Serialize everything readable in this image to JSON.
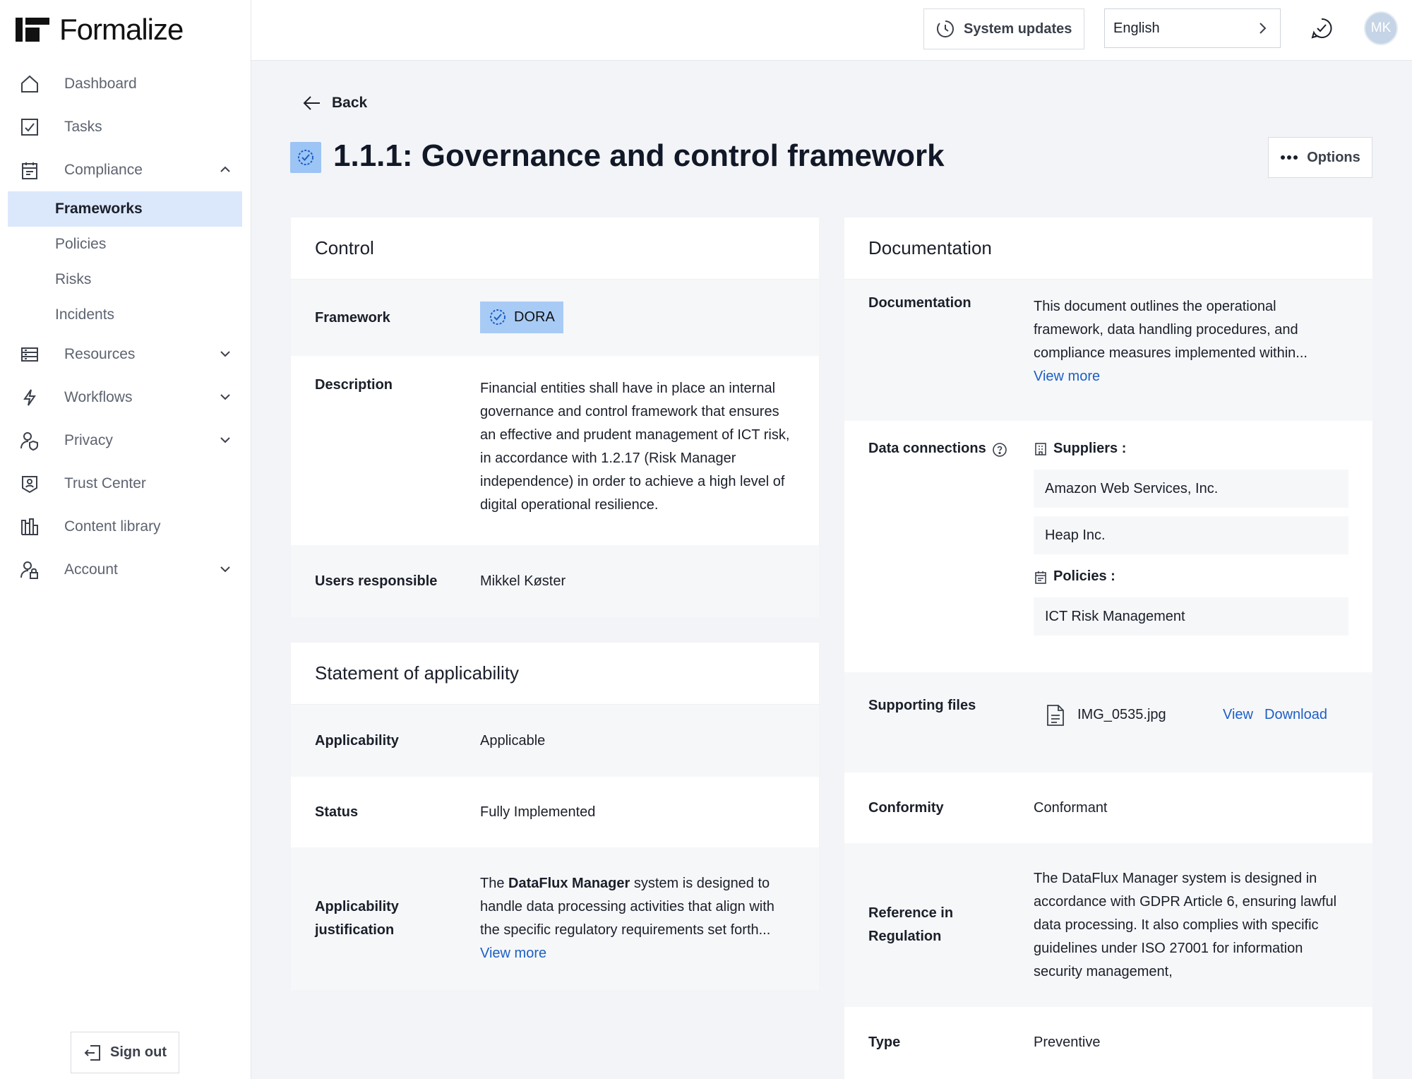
{
  "app": {
    "name": "Formalize"
  },
  "sidebar": {
    "items": [
      {
        "label": "Dashboard"
      },
      {
        "label": "Tasks"
      },
      {
        "label": "Compliance"
      },
      {
        "label": "Resources"
      },
      {
        "label": "Workflows"
      },
      {
        "label": "Privacy"
      },
      {
        "label": "Trust Center"
      },
      {
        "label": "Content library"
      },
      {
        "label": "Account"
      }
    ],
    "compliance_sub": [
      {
        "label": "Frameworks",
        "active": true
      },
      {
        "label": "Policies"
      },
      {
        "label": "Risks"
      },
      {
        "label": "Incidents"
      }
    ],
    "sign_out": "Sign out"
  },
  "topbar": {
    "system_updates": "System updates",
    "language": "English",
    "avatar_initials": "MK"
  },
  "page": {
    "back": "Back",
    "title": "1.1.1: Governance and control framework",
    "options": "Options"
  },
  "control": {
    "heading": "Control",
    "framework_label": "Framework",
    "framework_value": "DORA",
    "description_label": "Description",
    "description_value": "Financial entities shall have in place an internal governance and control framework that ensures an effective and prudent management of ICT risk, in accordance with 1.2.17 (Risk Manager independence) in order to achieve a high level of digital operational resilience.",
    "users_label": "Users responsible",
    "users_value": "Mikkel Køster"
  },
  "soa": {
    "heading": "Statement of applicability",
    "applicability_label": "Applicability",
    "applicability_value": "Applicable",
    "status_label": "Status",
    "status_value": "Fully Implemented",
    "justification_label": "Applicability justification",
    "justification_prefix": "The ",
    "justification_bold": "DataFlux Manager",
    "justification_rest": " system is designed to handle data processing activities that align with the specific regulatory requirements set forth...",
    "view_more": "View more"
  },
  "documentation": {
    "heading": "Documentation",
    "doc_label": "Documentation",
    "doc_value": "This document outlines the operational framework, data handling procedures, and compliance measures implemented within...",
    "view_more": "View more",
    "connections_label": "Data connections",
    "suppliers_label": "Suppliers :",
    "suppliers": [
      "Amazon Web Services, Inc.",
      "Heap Inc."
    ],
    "policies_label": "Policies :",
    "policies": [
      "ICT Risk Management"
    ],
    "files_label": "Supporting files",
    "file_name": "IMG_0535.jpg",
    "file_view": "View",
    "file_download": "Download",
    "conformity_label": "Conformity",
    "conformity_value": "Conformant",
    "reference_label": "Reference in Regulation",
    "reference_value": "The DataFlux Manager system is designed in accordance with GDPR Article 6, ensuring lawful data processing. It also complies with specific guidelines under ISO 27001 for information security management,",
    "type_label": "Type",
    "type_value": "Preventive"
  }
}
